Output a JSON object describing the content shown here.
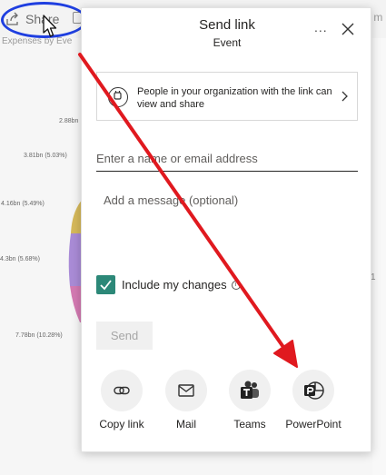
{
  "background": {
    "share_label": "Share",
    "subtitle": "Expenses by Eve",
    "right_text": "to m",
    "right_mark": "1",
    "pie_labels": [
      "2.88bn",
      "3.81bn (5.03%)",
      "4.16bn (5.49%)",
      "4.3bn (5.68%)",
      "7.78bn (10.28%)"
    ]
  },
  "dialog": {
    "title": "Send link",
    "subtitle": "Event",
    "more_label": "...",
    "permission_text": "People in your organization with the link can view and share",
    "name_placeholder": "Enter a name or email address",
    "message_placeholder": "Add a message (optional)",
    "include_changes_label": "Include my changes",
    "info_glyph": "i",
    "send_label": "Send",
    "share_options": [
      {
        "label": "Copy link",
        "icon": "link-icon"
      },
      {
        "label": "Mail",
        "icon": "mail-icon"
      },
      {
        "label": "Teams",
        "icon": "teams-icon"
      },
      {
        "label": "PowerPoint",
        "icon": "powerpoint-icon"
      }
    ]
  },
  "colors": {
    "annotation_circle": "#1f3fe0",
    "annotation_arrow": "#e0191f",
    "checkbox": "#2c8878"
  }
}
